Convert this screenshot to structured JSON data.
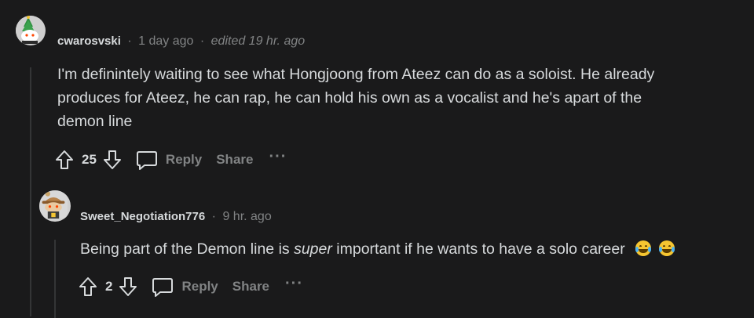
{
  "comments": [
    {
      "username": "cwarosvski",
      "separator": "·",
      "time": "1 day ago",
      "edited": "edited 19 hr. ago",
      "body": "I'm definintely waiting to see what Hongjoong from Ateez can do as a soloist. He already produces for Ateez, he can rap, he can hold his own as a vocalist and he's apart of the demon line",
      "body_lines": [
        "I'm definintely waiting to see what Hongjoong from Ateez can do as a soloist. He already",
        "produces for Ateez, he can rap, he can hold his own as a vocalist and he's apart of the",
        "demon line"
      ],
      "score": "25",
      "reply_label": "Reply",
      "share_label": "Share",
      "more_label": "···"
    },
    {
      "username": "Sweet_Negotiation776",
      "separator": "·",
      "time": "9 hr. ago",
      "body_before": "Being part of the Demon line is ",
      "body_emph": "super",
      "body_after": " important if he wants to have a solo career",
      "emojis": [
        "face-with-tears-of-joy-icon",
        "face-with-tears-of-joy-icon"
      ],
      "score": "2",
      "reply_label": "Reply",
      "share_label": "Share",
      "more_label": "···"
    }
  ],
  "colors": {
    "background": "#1a1a1b",
    "text": "#d7dadc",
    "muted": "#818384",
    "thread_line": "#343536"
  }
}
